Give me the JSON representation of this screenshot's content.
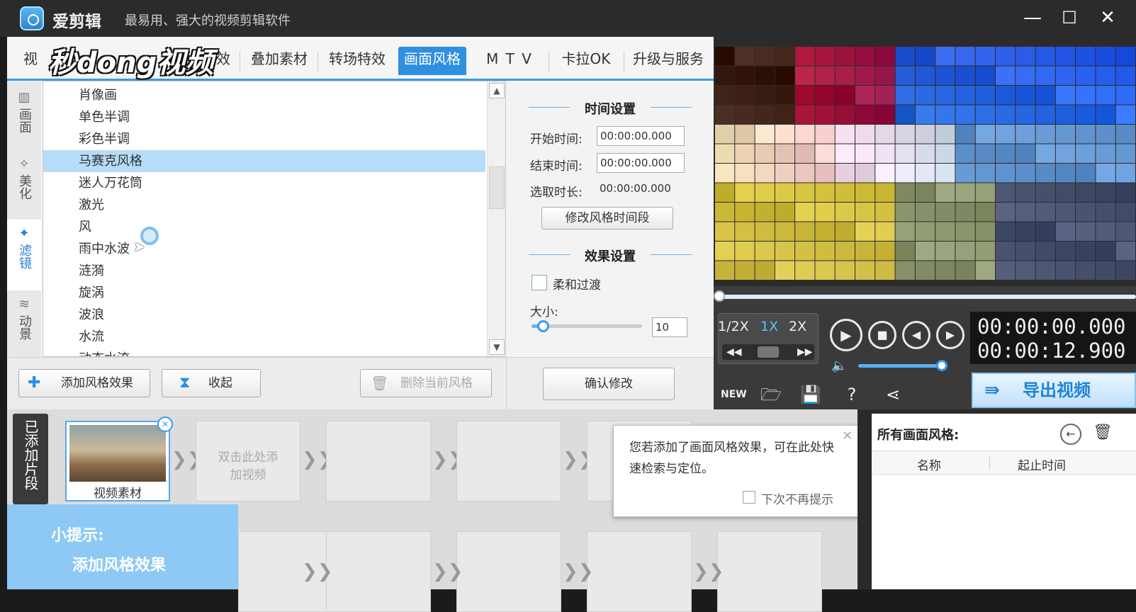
{
  "titlebar": {
    "app_name": "爱剪辑",
    "slogan": "最易用、强大的视频剪辑软件",
    "minimize": "—",
    "maximize": "☐",
    "close": "✕"
  },
  "watermark": "秒dong视频",
  "tabs": [
    {
      "label": "视"
    },
    {
      "label": "效"
    },
    {
      "label": "叠加素材"
    },
    {
      "label": "转场特效"
    },
    {
      "label": "画面风格"
    },
    {
      "label": "M T V"
    },
    {
      "label": "卡拉OK"
    },
    {
      "label": "升级与服务"
    }
  ],
  "sidenav": [
    {
      "icon": "▥",
      "label": "画面"
    },
    {
      "icon": "✧",
      "label": "美化"
    },
    {
      "icon": "✦",
      "label": "滤镜"
    },
    {
      "icon": "≋",
      "label": "动景"
    }
  ],
  "filters": [
    "肖像画",
    "单色半调",
    "彩色半调",
    "马赛克风格",
    "迷人万花筒",
    "激光",
    "风",
    "雨中水波",
    "涟漪",
    "旋涡",
    "波浪",
    "水流",
    "动态水流"
  ],
  "settings": {
    "time_header": "时间设置",
    "start_label": "开始时间:",
    "start_value": "00:00:00.000",
    "end_label": "结束时间:",
    "end_value": "00:00:00.000",
    "duration_label": "选取时长:",
    "duration_value": "00:00:00.000",
    "modify_time_btn": "修改风格时间段",
    "effect_header": "效果设置",
    "smooth_label": "柔和过渡",
    "size_label": "大小:",
    "size_value": "10",
    "size_fraction": 0.1
  },
  "bottombar": {
    "add_btn": "添加风格效果",
    "collapse_btn": "收起",
    "delete_btn": "删除当前风格",
    "confirm_btn": "确认修改"
  },
  "player": {
    "speeds": [
      "1/2X",
      "1X",
      "2X"
    ],
    "current_time": "00:00:00.000",
    "total_time": "00:00:12.900",
    "export_btn": "导出视频",
    "accent": "#2f8fe0"
  },
  "clips": {
    "label": "已添加片段",
    "clip_name": "视频素材",
    "empty_hint": "双击此处添加视频"
  },
  "tip": {
    "title": "小提示:",
    "text": "添加风格效果"
  },
  "popup": {
    "text": "您若添加了画面风格效果，可在此处快速检索与定位。",
    "checkbox_label": "下次不再提示",
    "close": "✕"
  },
  "rightlist": {
    "title": "所有画面风格:",
    "col_name": "名称",
    "col_time": "起止时间"
  }
}
